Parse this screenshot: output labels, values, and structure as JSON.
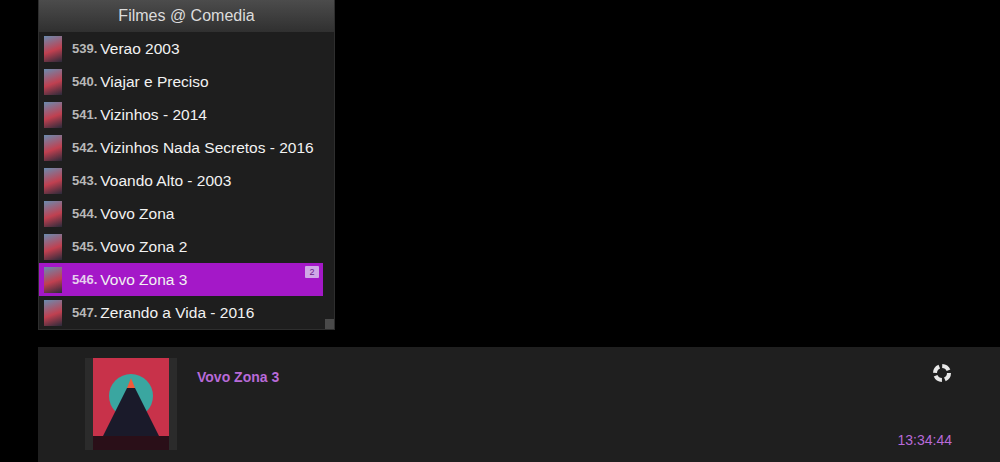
{
  "list": {
    "title": "Filmes @ Comedia",
    "items": [
      {
        "number": "539.",
        "title": "Verao 2003",
        "selected": false
      },
      {
        "number": "540.",
        "title": "Viajar e Preciso",
        "selected": false
      },
      {
        "number": "541.",
        "title": "Vizinhos - 2014",
        "selected": false
      },
      {
        "number": "542.",
        "title": "Vizinhos Nada Secretos - 2016",
        "selected": false
      },
      {
        "number": "543.",
        "title": "Voando Alto - 2003",
        "selected": false
      },
      {
        "number": "544.",
        "title": "Vovo Zona",
        "selected": false
      },
      {
        "number": "545.",
        "title": "Vovo Zona 2",
        "selected": false
      },
      {
        "number": "546.",
        "title": "Vovo Zona 3",
        "selected": true,
        "badge": "2"
      },
      {
        "number": "547.",
        "title": "Zerando a Vida - 2016",
        "selected": false
      }
    ]
  },
  "scrollbar": {
    "level": 1
  },
  "details": {
    "title": "Vovo Zona 3",
    "time": "13:34:44"
  }
}
